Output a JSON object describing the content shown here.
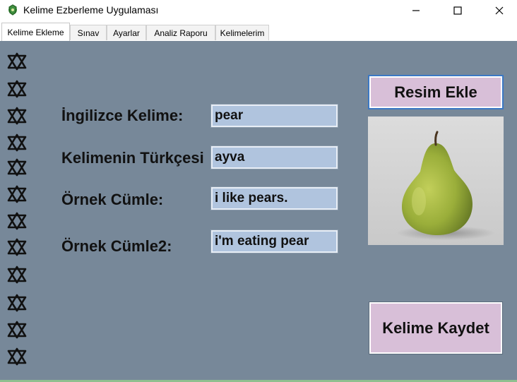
{
  "window": {
    "title": "Kelime Ezberleme Uygulaması"
  },
  "tabs": [
    {
      "label": "Kelime Ekleme",
      "active": true
    },
    {
      "label": "Sınav",
      "active": false
    },
    {
      "label": "Ayarlar",
      "active": false
    },
    {
      "label": "Analiz Raporu",
      "active": false
    },
    {
      "label": "Kelimelerim",
      "active": false
    }
  ],
  "form": {
    "english_word": {
      "label": "İngilizce Kelime:",
      "value": "pear"
    },
    "turkish_word": {
      "label": "Kelimenin Türkçesi",
      "value": "ayva"
    },
    "example1": {
      "label": "Örnek Cümle:",
      "value": "i like pears."
    },
    "example2": {
      "label": "Örnek Cümle2:",
      "value": "i'm eating pear"
    }
  },
  "buttons": {
    "add_image": "Resim Ekle",
    "save_word": "Kelime Kaydet"
  },
  "image": {
    "subject": "pear"
  },
  "colors": {
    "panel_bg": "#778899",
    "field_bg": "#b0c4de",
    "button_bg": "#d8bfd8",
    "pear_green": "#9aae3a"
  },
  "decorations": {
    "icon": "star-of-david-icon",
    "count": 12
  }
}
